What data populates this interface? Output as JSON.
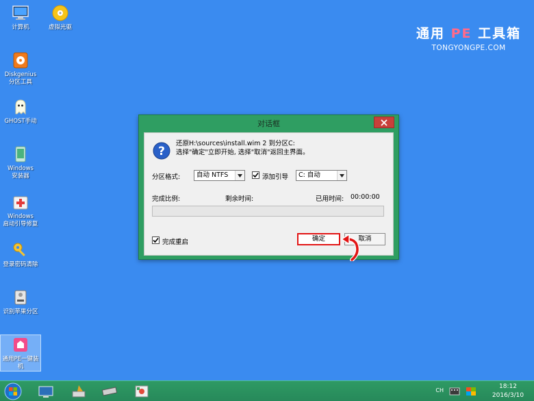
{
  "desktop": {
    "icons": [
      {
        "label": "计算机",
        "icon": "computer-icon"
      },
      {
        "label": "虚拟光驱",
        "icon": "virtual-drive-icon"
      },
      {
        "label": "Diskgenius\n分区工具",
        "icon": "diskgenius-icon"
      },
      {
        "label": "GHOST手动",
        "icon": "ghost-icon"
      },
      {
        "label": "Windows\n安装器",
        "icon": "windows-installer-icon"
      },
      {
        "label": "Windows\n启动引导修复",
        "icon": "boot-repair-icon"
      },
      {
        "label": "登录密码清除",
        "icon": "key-icon"
      },
      {
        "label": "识别苹果分区",
        "icon": "apple-partition-icon"
      },
      {
        "label": "通用PE一键装\n机",
        "icon": "pe-installer-icon"
      }
    ]
  },
  "brand": {
    "title_part1": "通用 ",
    "title_pe": "PE",
    "title_part2": " 工具箱",
    "subtitle": "TONGYONGPE.COM"
  },
  "dialog": {
    "title": "对话框",
    "message_line1": "还原H:\\sources\\install.wim 2 到分区C:",
    "message_line2": "选择\"确定\"立即开始, 选择\"取消\"返回主界面。",
    "format_label": "分区格式:",
    "format_value": "自动 NTFS",
    "add_boot_label": "添加引导",
    "add_boot_checked": true,
    "boot_value": "C: 自动",
    "progress_label": "完成比例:",
    "remaining_label": "剩余时间:",
    "elapsed_label": "已用时间:",
    "elapsed_value": "00:00:00",
    "progress_fraction": 0,
    "reboot_label": "完成重启",
    "reboot_checked": true,
    "ok_label": "确定",
    "cancel_label": "取消"
  },
  "taskbar": {
    "tray_lang": "CH",
    "time": "18:12",
    "date": "2016/3/10"
  },
  "colors": {
    "desktop": "#3a8bf0",
    "dialog_frame": "#2f9e62",
    "taskbar": "#2e9a64",
    "highlight_red": "#e21414",
    "brand_pe": "#ff6a8a"
  }
}
